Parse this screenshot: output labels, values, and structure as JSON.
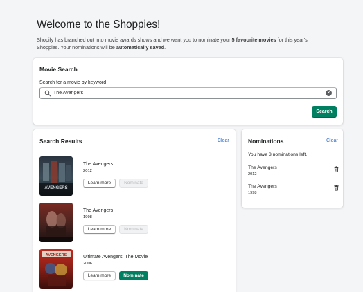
{
  "header": {
    "title": "Welcome to the Shoppies!",
    "intro_1": "Shopify has branched out into movie awards shows and we want you to nominate your ",
    "intro_bold_1": "5 favourite movies",
    "intro_2": " for this year's Shoppies. Your nominations will be ",
    "intro_bold_2": "automatically saved",
    "intro_3": "."
  },
  "search": {
    "card_title": "Movie Search",
    "field_label": "Search for a movie by keyword",
    "value": "The Avengers",
    "button_label": "Search"
  },
  "results": {
    "card_title": "Search Results",
    "clear_label": "Clear",
    "items": [
      {
        "title": "The Avengers",
        "year": "2012",
        "learn_label": "Learn more",
        "nominate_label": "Nominate",
        "nominated": true,
        "poster": "avengers-2012-poster"
      },
      {
        "title": "The Avengers",
        "year": "1998",
        "learn_label": "Learn more",
        "nominate_label": "Nominate",
        "nominated": true,
        "poster": "avengers-1998-poster"
      },
      {
        "title": "Ultimate Avengers: The Movie",
        "year": "2006",
        "learn_label": "Learn more",
        "nominate_label": "Nominate",
        "nominated": false,
        "poster": "ultimate-avengers-poster"
      }
    ]
  },
  "nominations": {
    "card_title": "Nominations",
    "clear_label": "Clear",
    "status": "You have 3 nominations left.",
    "items": [
      {
        "title": "The Avengers",
        "year": "2012",
        "icon": "trash-icon"
      },
      {
        "title": "The Avengers",
        "year": "1998",
        "icon": "trash-icon"
      }
    ]
  },
  "colors": {
    "primary": "#008060",
    "link": "#2c6ecb",
    "background": "#f4f5f6"
  }
}
